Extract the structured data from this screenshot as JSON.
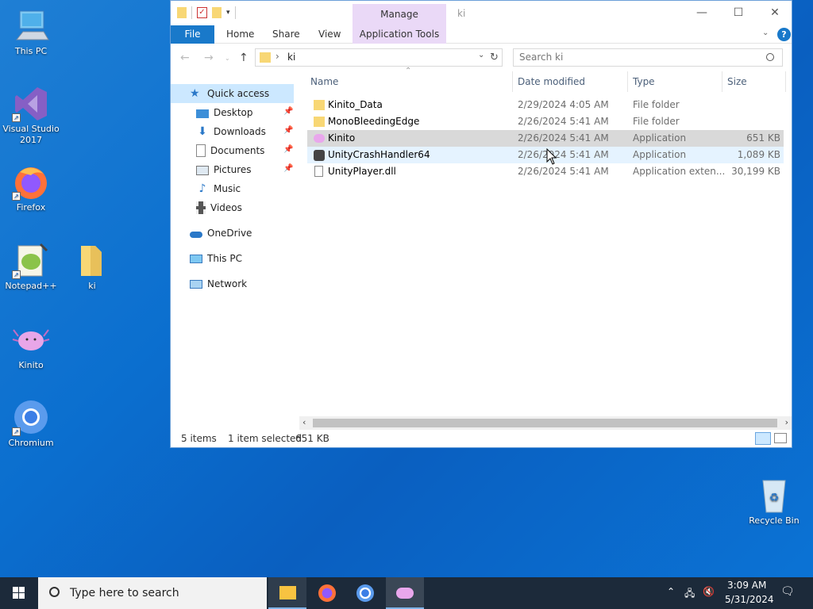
{
  "desktop": {
    "icons": [
      {
        "label": "This PC",
        "icon": "this-pc-icon"
      },
      {
        "label": "Visual Studio\n2017",
        "line1": "Visual Studio",
        "line2": "2017",
        "icon": "visual-studio-icon"
      },
      {
        "label": "Firefox",
        "icon": "firefox-icon"
      },
      {
        "label": "Notepad++",
        "icon": "notepadpp-icon"
      },
      {
        "label": "ki",
        "icon": "folder-icon"
      },
      {
        "label": "Kinito",
        "icon": "kinito-axolotl-icon"
      },
      {
        "label": "Chromium",
        "icon": "chromium-icon"
      },
      {
        "label": "Recycle Bin",
        "icon": "recycle-bin-icon"
      }
    ]
  },
  "explorer": {
    "title": "ki",
    "manage_tab": "Manage",
    "ribbon_tabs": [
      "File",
      "Home",
      "Share",
      "View",
      "Application Tools"
    ],
    "address": {
      "path": "ki"
    },
    "search": {
      "placeholder": "Search ki"
    },
    "nav": {
      "quick_access": "Quick access",
      "items": [
        {
          "label": "Desktop",
          "pinned": true
        },
        {
          "label": "Downloads",
          "pinned": true
        },
        {
          "label": "Documents",
          "pinned": true
        },
        {
          "label": "Pictures",
          "pinned": true
        },
        {
          "label": "Music",
          "pinned": false
        },
        {
          "label": "Videos",
          "pinned": false
        }
      ],
      "onedrive": "OneDrive",
      "this_pc": "This PC",
      "network": "Network"
    },
    "columns": {
      "name": "Name",
      "date": "Date modified",
      "type": "Type",
      "size": "Size"
    },
    "files": [
      {
        "name": "Kinito_Data",
        "date": "2/29/2024 4:05 AM",
        "type": "File folder",
        "size": ""
      },
      {
        "name": "MonoBleedingEdge",
        "date": "2/26/2024 5:41 AM",
        "type": "File folder",
        "size": ""
      },
      {
        "name": "Kinito",
        "date": "2/26/2024 5:41 AM",
        "type": "Application",
        "size": "651 KB"
      },
      {
        "name": "UnityCrashHandler64",
        "date": "2/26/2024 5:41 AM",
        "type": "Application",
        "size": "1,089 KB"
      },
      {
        "name": "UnityPlayer.dll",
        "date": "2/26/2024 5:41 AM",
        "type": "Application exten...",
        "size": "30,199 KB"
      }
    ],
    "status": {
      "count": "5 items",
      "selected": "1 item selected",
      "size": "651 KB"
    }
  },
  "taskbar": {
    "search_placeholder": "Type here to search",
    "time": "3:09 AM",
    "date": "5/31/2024"
  },
  "colors": {
    "accent": "#1979ca",
    "manage": "#ead9f7",
    "selected_row": "#d9d9d9",
    "hover_row": "#e5f3ff"
  }
}
